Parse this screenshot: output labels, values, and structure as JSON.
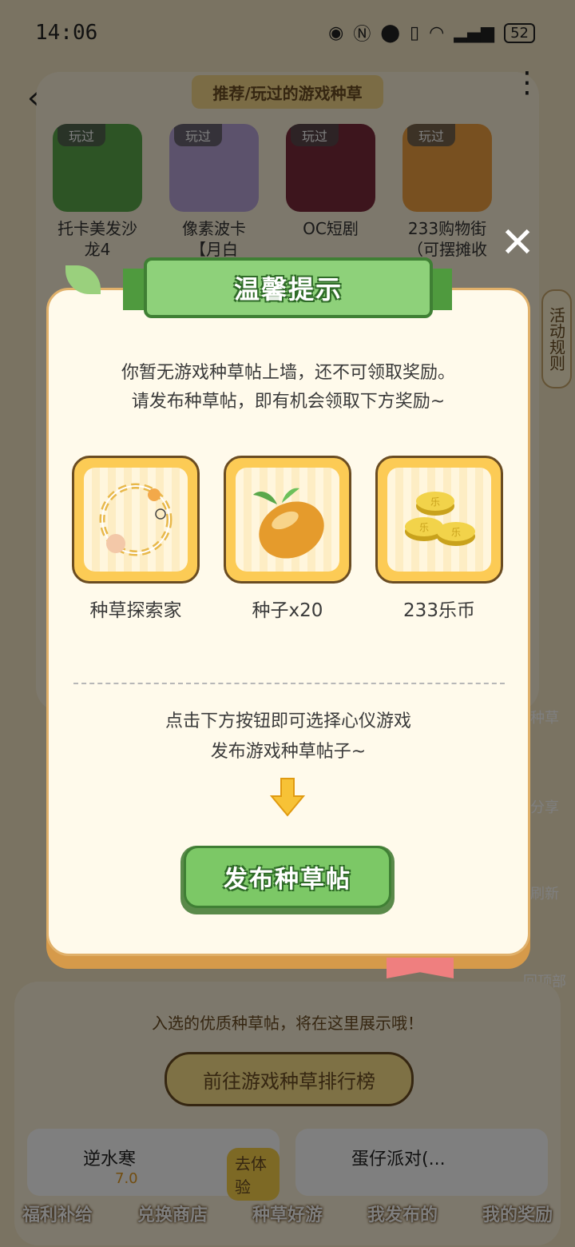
{
  "status_bar": {
    "time": "14:06",
    "battery": "52"
  },
  "header": {
    "section_title": "推荐/玩过的游戏种草"
  },
  "played_games": [
    {
      "badge": "玩过",
      "name_line1": "托卡美发沙",
      "name_line2": "龙4",
      "color": "#5aa84a"
    },
    {
      "badge": "玩过",
      "name_line1": "像素波卡",
      "name_line2": "【月白",
      "color": "#b9a4d8"
    },
    {
      "badge": "玩过",
      "name_line1": "OC短剧",
      "name_line2": "",
      "color": "#7a2a3a"
    },
    {
      "badge": "玩过",
      "name_line1": "233购物街",
      "name_line2": "（可摆摊收",
      "color": "#f0a040"
    }
  ],
  "side_buttons": {
    "rules": "活动规则",
    "grass": "种草",
    "share": "分享",
    "refresh": "刷新",
    "top": "回顶部"
  },
  "bottom_panel": {
    "hint": "入选的优质种草帖，将在这里展示哦！",
    "rank_button": "前往游戏种草排行榜",
    "cards": [
      {
        "name": "逆水寒",
        "score": "7.0",
        "action": "去体验"
      },
      {
        "name": "蛋仔派对(...",
        "score": "",
        "action": ""
      }
    ]
  },
  "tabs": [
    "福利补给",
    "兑换商店",
    "种草好游",
    "我发布的",
    "我的奖励"
  ],
  "dialog": {
    "title": "温馨提示",
    "line1": "你暂无游戏种草帖上墙，还不可领取奖励。",
    "line2": "请发布种草帖，即有机会领取下方奖励~",
    "rewards": [
      {
        "label": "种草探索家",
        "icon": "avatar-frame-icon"
      },
      {
        "label": "种子x20",
        "icon": "seed-icon"
      },
      {
        "label": "233乐币",
        "icon": "coins-icon"
      }
    ],
    "coin_char": "乐",
    "hint1": "点击下方按钮即可选择心仪游戏",
    "hint2": "发布游戏种草帖子~",
    "publish_button": "发布种草帖",
    "close_icon": "close-icon"
  },
  "colors": {
    "accent_green": "#7cc866",
    "reward_gold": "#fccb55",
    "dialog_bg": "#fffaeb"
  }
}
